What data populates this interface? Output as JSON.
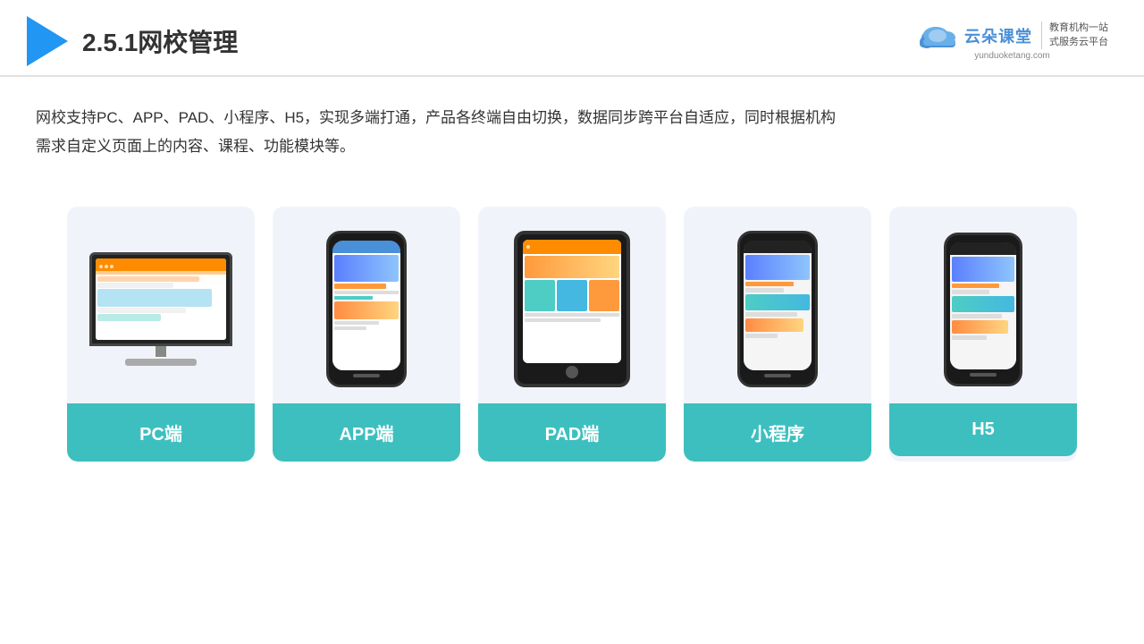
{
  "header": {
    "title": "2.5.1网校管理",
    "brand": {
      "name": "云朵课堂",
      "url": "yunduoketang.com",
      "tagline": "教育机构一站\n式服务云平台"
    }
  },
  "description": "网校支持PC、APP、PAD、小程序、H5，实现多端打通，产品各终端自由切换，数据同步跨平台自适应，同时根据机构\n需求自定义页面上的内容、课程、功能模块等。",
  "cards": [
    {
      "id": "pc",
      "label": "PC端"
    },
    {
      "id": "app",
      "label": "APP端"
    },
    {
      "id": "pad",
      "label": "PAD端"
    },
    {
      "id": "miniprogram",
      "label": "小程序"
    },
    {
      "id": "h5",
      "label": "H5"
    }
  ],
  "colors": {
    "accent": "#3dbfbf",
    "title": "#333333",
    "text": "#333333",
    "triangle": "#2196f3",
    "brand": "#4a90d9"
  }
}
